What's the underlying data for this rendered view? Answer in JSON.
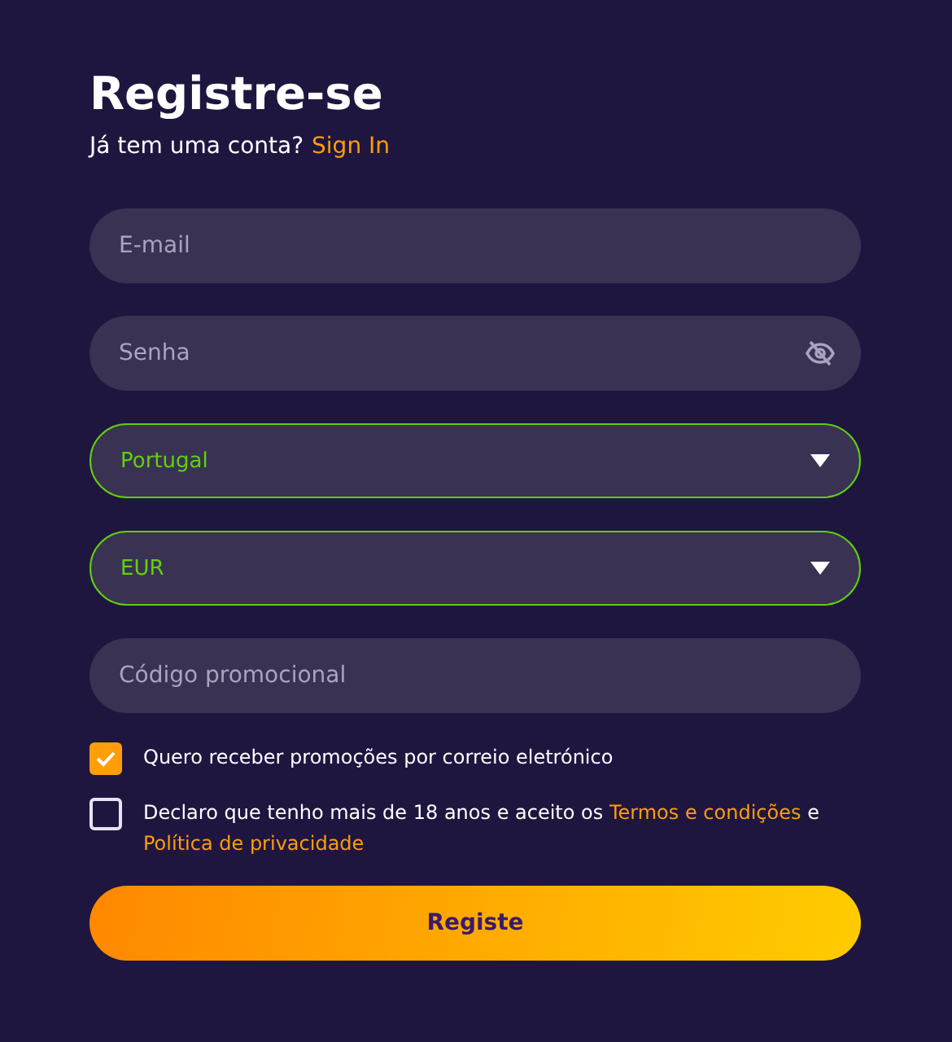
{
  "title": "Registre-se",
  "signin_prompt": {
    "text": "Já tem uma conta?",
    "link": "Sign In"
  },
  "fields": [
    {
      "kind": "input",
      "placeholder": "E-mail"
    },
    {
      "kind": "password",
      "placeholder": "Senha"
    },
    {
      "kind": "select",
      "value": "Portugal",
      "valid": true
    },
    {
      "kind": "select",
      "value": "EUR",
      "valid": true
    },
    {
      "kind": "input",
      "placeholder": "Código promocional"
    }
  ],
  "consents": [
    {
      "checked": true,
      "parts": [
        {
          "kind": "text",
          "text": "Quero receber promoções por correio eletrónico"
        }
      ]
    },
    {
      "checked": false,
      "parts": [
        {
          "kind": "text",
          "text": "Declaro que tenho mais de 18 anos e aceito os"
        },
        {
          "kind": "link",
          "text": "Termos e condições"
        },
        {
          "kind": "text",
          "text": "e"
        },
        {
          "kind": "link",
          "text": "Política de privacidade"
        }
      ]
    }
  ],
  "submit": "Registe"
}
